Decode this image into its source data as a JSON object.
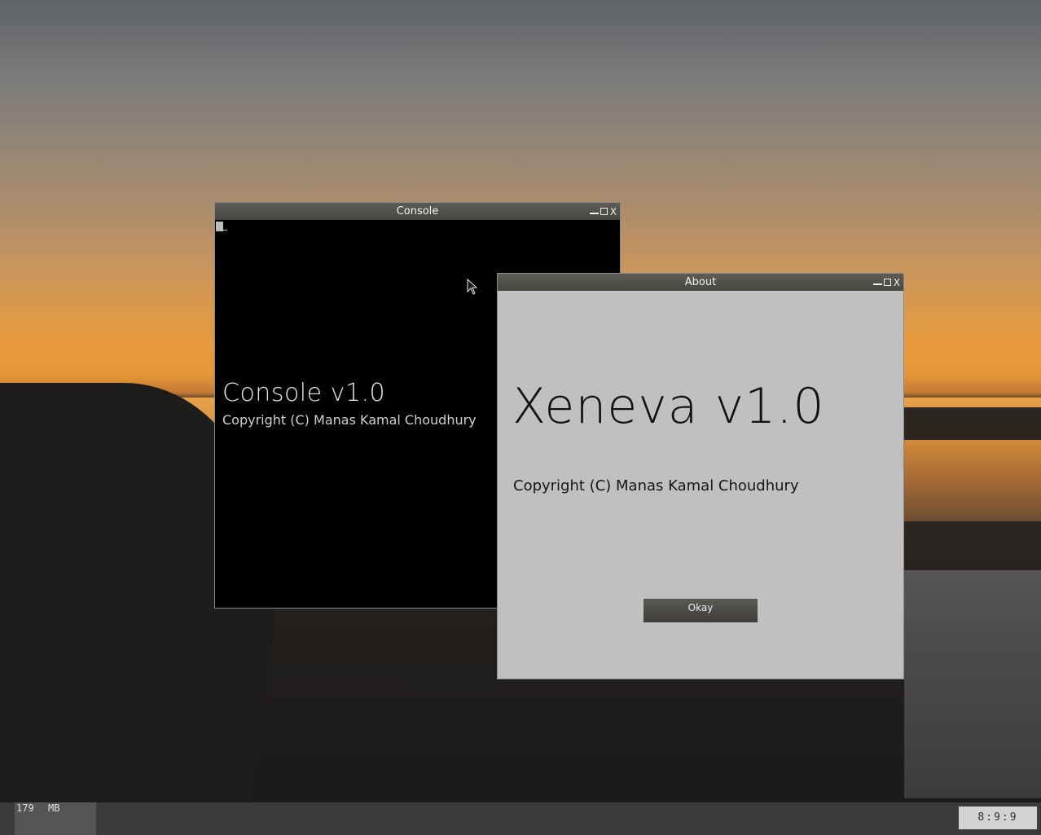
{
  "console_window": {
    "title": "Console",
    "heading": "Console v1.0",
    "copyright": "Copyright (C) Manas Kamal Choudhury",
    "controls": {
      "minimize": "minimize-icon",
      "maximize": "maximize-icon",
      "close": "X"
    }
  },
  "about_window": {
    "title": "About",
    "heading": "Xeneva v1.0",
    "copyright": "Copyright (C) Manas Kamal Choudhury",
    "okay_label": "Okay",
    "controls": {
      "minimize": "minimize-icon",
      "maximize": "maximize-icon",
      "close": "X"
    }
  },
  "taskbar": {
    "memory_value": "179",
    "memory_unit": "MB",
    "clock": "8:9:9"
  },
  "colors": {
    "titlebar": "#4f4d47",
    "console_bg": "#000000",
    "about_bg": "#c0c0c0",
    "taskbar": "#3b3b3b"
  }
}
